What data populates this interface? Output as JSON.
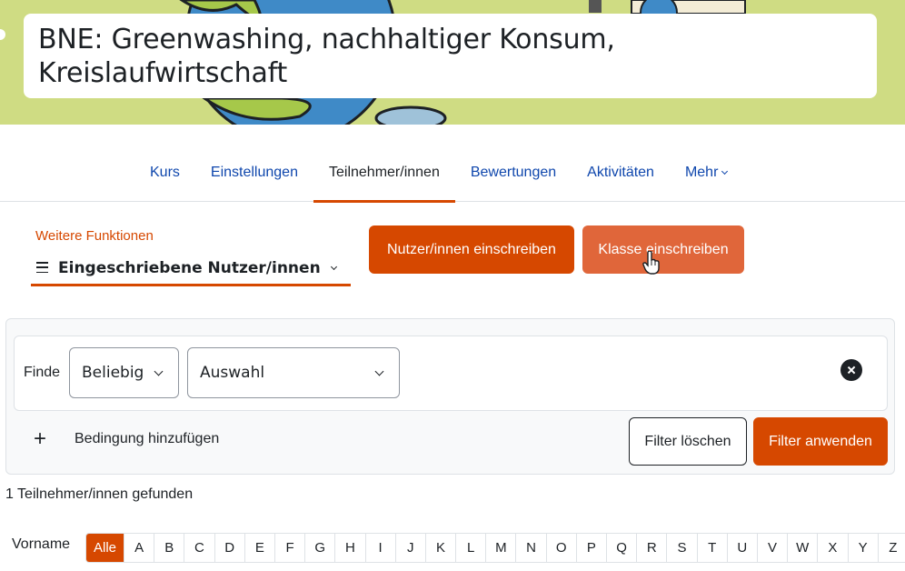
{
  "course": {
    "title": "BNE: Greenwashing, nachhaltiger Konsum, Kreislaufwirtschaft"
  },
  "nav": {
    "items": [
      {
        "label": "Kurs"
      },
      {
        "label": "Einstellungen"
      },
      {
        "label": "Teilnehmer/innen",
        "active": true
      },
      {
        "label": "Bewertungen"
      },
      {
        "label": "Aktivitäten"
      },
      {
        "label": "Mehr"
      }
    ]
  },
  "actions": {
    "more_label": "Weitere Funktionen",
    "participants_select": "Eingeschriebene Nutzer/innen",
    "enrol_users": "Nutzer/innen einschreiben",
    "enrol_cohort": "Klasse einschreiben"
  },
  "filter": {
    "find_label": "Finde",
    "match_select": "Beliebig",
    "type_select": "Auswahl",
    "add_condition": "Bedingung hinzufügen",
    "clear_filters": "Filter löschen",
    "apply_filters": "Filter anwenden"
  },
  "results": {
    "count_text": "1 Teilnehmer/innen gefunden"
  },
  "initials_bar": {
    "label": "Vorname",
    "items": [
      "Alle",
      "A",
      "B",
      "C",
      "D",
      "E",
      "F",
      "G",
      "H",
      "I",
      "J",
      "K",
      "L",
      "M",
      "N",
      "O",
      "P",
      "Q",
      "R",
      "S",
      "T",
      "U",
      "V",
      "W",
      "X",
      "Y",
      "Z"
    ],
    "active": "Alle"
  },
  "colors": {
    "brand": "#d64800",
    "banner": "#cfdc83",
    "link": "#0f47ad"
  }
}
